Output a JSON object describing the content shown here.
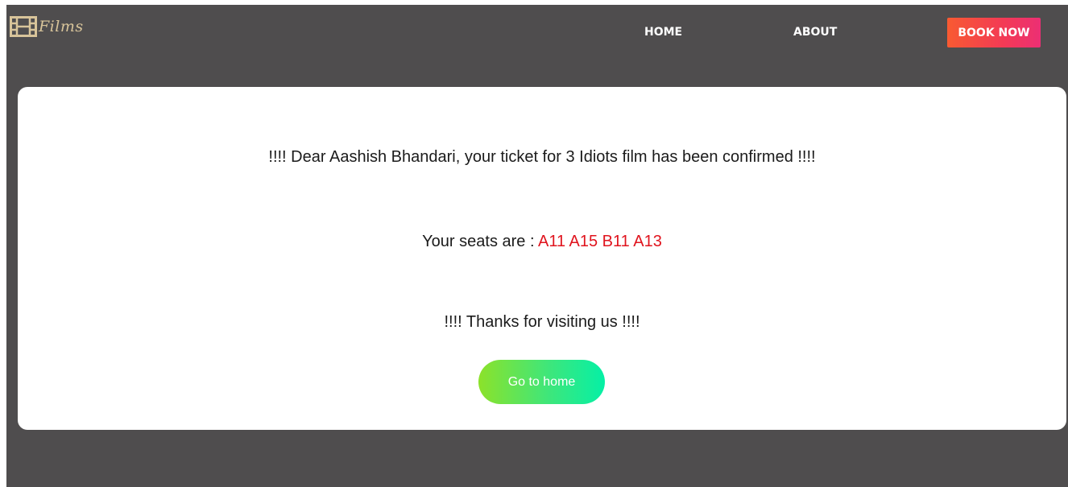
{
  "nav": {
    "logo_text": "Films",
    "logo_icon": "film-strip-icon",
    "links": [
      {
        "label": "HOME"
      },
      {
        "label": "ABOUT"
      }
    ],
    "book_label": "BOOK NOW"
  },
  "confirmation": {
    "message": "!!!! Dear Aashish Bhandari, your ticket for 3 Idiots film has been confirmed !!!!",
    "seats_label": "Your seats are :",
    "seats_value": "A11 A15 B11 A13",
    "thanks": "!!!! Thanks for visiting us !!!!",
    "home_button_label": "Go to home"
  },
  "colors": {
    "page_background": "#4f4d4e",
    "card_background": "#ffffff",
    "seats_highlight": "#e0141e",
    "logo": "#d8c49a",
    "book_button_gradient": [
      "#f85a32",
      "#ec2f74"
    ],
    "home_button_gradient": [
      "#8ce22a",
      "#05f0a6"
    ]
  }
}
